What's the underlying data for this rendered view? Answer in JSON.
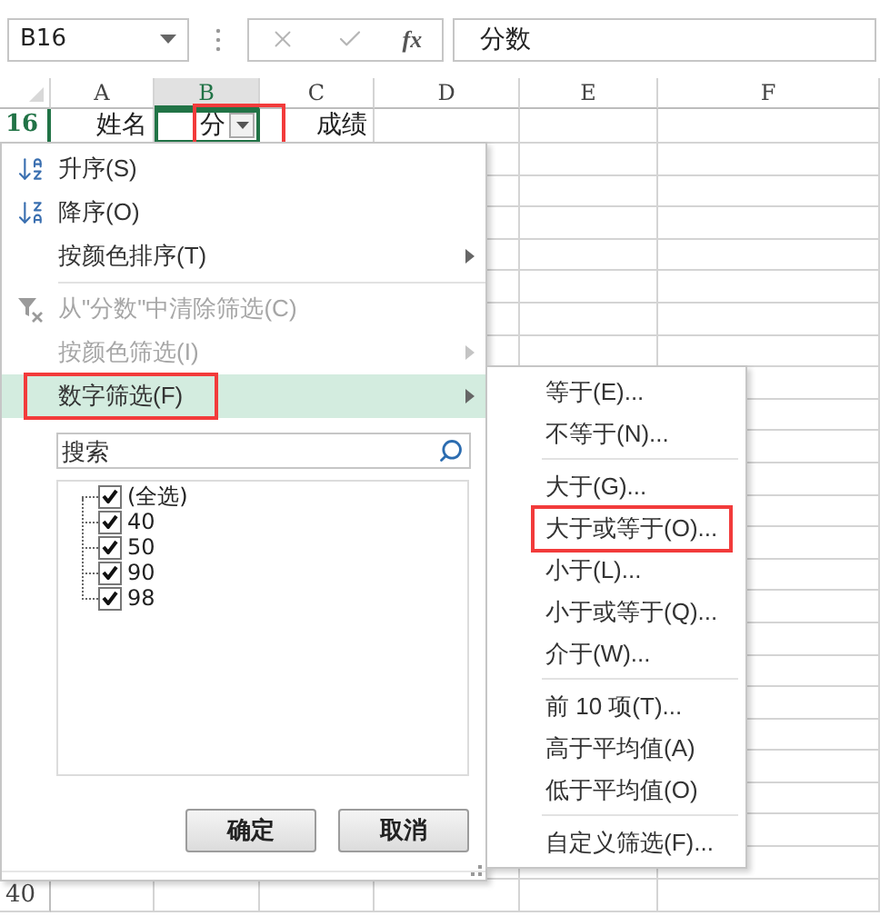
{
  "formula_bar": {
    "name_box": "B16",
    "function_button": "fx",
    "formula": "分数"
  },
  "sheet": {
    "columns": [
      {
        "label": "A",
        "selected": false
      },
      {
        "label": "B",
        "selected": true
      },
      {
        "label": "C",
        "selected": false
      },
      {
        "label": "D",
        "selected": false
      },
      {
        "label": "E",
        "selected": false
      },
      {
        "label": "F",
        "selected": false
      }
    ],
    "rows": [
      {
        "number": "16",
        "selected": true,
        "cells": [
          {
            "text": "姓名",
            "filter_button": false,
            "selected": false,
            "highlighted": false
          },
          {
            "text": "分",
            "filter_button": true,
            "selected": true,
            "highlighted": true
          },
          {
            "text": "成绩",
            "filter_button": false,
            "selected": false,
            "highlighted": false
          }
        ]
      }
    ],
    "bottom_rows": [
      {
        "number": "40"
      }
    ]
  },
  "filter_menu": {
    "items": [
      {
        "kind": "sort_ascending",
        "label": "升序(S)",
        "disabled": false,
        "selected": false,
        "has_submenu": false,
        "highlighted": false
      },
      {
        "kind": "sort_descending",
        "label": "降序(O)",
        "disabled": false,
        "selected": false,
        "has_submenu": false,
        "highlighted": false
      },
      {
        "kind": "item",
        "label": "按颜色排序(T)",
        "disabled": false,
        "selected": false,
        "has_submenu": true,
        "highlighted": false
      },
      {
        "kind": "separator"
      },
      {
        "kind": "clear_filter",
        "label": "从\"分数\"中清除筛选(C)",
        "disabled": true,
        "selected": false,
        "has_submenu": false,
        "highlighted": false
      },
      {
        "kind": "item",
        "label": "按颜色筛选(I)",
        "disabled": true,
        "selected": false,
        "has_submenu": true,
        "highlighted": false
      },
      {
        "kind": "item",
        "label": "数字筛选(F)",
        "disabled": false,
        "selected": true,
        "has_submenu": true,
        "highlighted": true
      }
    ],
    "search": {
      "placeholder": "搜索"
    },
    "values": [
      {
        "label": "(全选)",
        "checked": true
      },
      {
        "label": "40",
        "checked": true
      },
      {
        "label": "50",
        "checked": true
      },
      {
        "label": "90",
        "checked": true
      },
      {
        "label": "98",
        "checked": true
      }
    ],
    "buttons": [
      "确定",
      "取消"
    ]
  },
  "number_filter_menu": {
    "items": [
      {
        "kind": "item",
        "label": "等于(E)...",
        "highlighted": false
      },
      {
        "kind": "item",
        "label": "不等于(N)...",
        "highlighted": false
      },
      {
        "kind": "separator"
      },
      {
        "kind": "item",
        "label": "大于(G)...",
        "highlighted": false
      },
      {
        "kind": "item",
        "label": "大于或等于(O)...",
        "highlighted": true
      },
      {
        "kind": "item",
        "label": "小于(L)...",
        "highlighted": false
      },
      {
        "kind": "item",
        "label": "小于或等于(Q)...",
        "highlighted": false
      },
      {
        "kind": "item",
        "label": "介于(W)...",
        "highlighted": false
      },
      {
        "kind": "separator"
      },
      {
        "kind": "item",
        "label": "前 10 项(T)...",
        "highlighted": false
      },
      {
        "kind": "item",
        "label": "高于平均值(A)",
        "highlighted": false
      },
      {
        "kind": "item",
        "label": "低于平均值(O)",
        "highlighted": false
      },
      {
        "kind": "separator"
      },
      {
        "kind": "item",
        "label": "自定义筛选(F)...",
        "highlighted": false
      }
    ]
  }
}
